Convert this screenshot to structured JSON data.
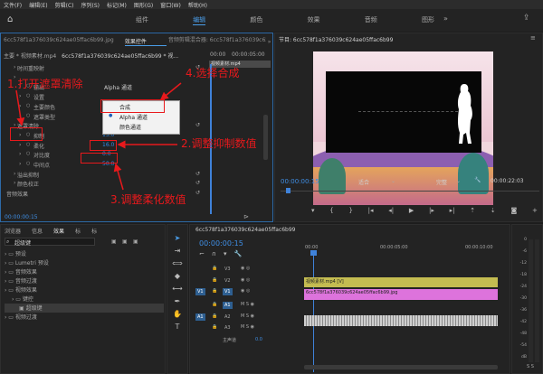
{
  "menu": [
    "文件(F)",
    "编辑(E)",
    "剪辑(C)",
    "序列(S)",
    "标记(M)",
    "图形(G)",
    "窗口(W)",
    "帮助(H)"
  ],
  "workspaces": [
    "组件",
    "编辑",
    "颜色",
    "效果",
    "音频",
    "图形"
  ],
  "source_tabs": {
    "file": "6cc578f1a376039c624ae05ffac6b99.jpg",
    "effect_controls": "效果控件",
    "audio_mixer": "音频剪辑混合器: 6cc578f1a376039c624ae05ffac6b99",
    "menu": "»"
  },
  "ec": {
    "clip_path": "主要 * 视频素材.mp4",
    "clip_seq": "6cc578f1a376039c624ae05ffac6b99 * 视...",
    "ruler_start": "00:00",
    "ruler_end": "00:00:05:00",
    "clip_label": "视频素材.mp4",
    "rows": [
      {
        "label": "时间重映射",
        "indent": 1
      },
      {
        "label": "",
        "indent": 1
      },
      {
        "label": "输出",
        "indent": 2,
        "value": "Alpha 通道"
      },
      {
        "label": "设置",
        "indent": 2
      },
      {
        "label": "主要颜色",
        "indent": 2
      },
      {
        "label": "遮罩类型",
        "indent": 2
      },
      {
        "label": "遮罩清除",
        "indent": 1
      },
      {
        "label": "抑制",
        "indent": 2,
        "value": "13.0"
      },
      {
        "label": "柔化",
        "indent": 2,
        "value": "16.0"
      },
      {
        "label": "对比度",
        "indent": 2,
        "value": "0.0"
      },
      {
        "label": "中间点",
        "indent": 2,
        "value": "50.0"
      },
      {
        "label": "溢出抑制",
        "indent": 1
      },
      {
        "label": "颜色校正",
        "indent": 1
      },
      {
        "label": "音频效果",
        "indent": 0
      }
    ],
    "timecode": "00:00:00:15",
    "dropdown": [
      {
        "label": "合成",
        "checked": false
      },
      {
        "label": "Alpha 通道",
        "checked": true
      },
      {
        "label": "颜色通道",
        "checked": false
      }
    ]
  },
  "program": {
    "title": "节目: 6cc578f1a376039c624ae05ffac6b99",
    "timecode": "00:00:00:15",
    "fit": "适合",
    "quality": "完整",
    "duration": "00:00:22:03"
  },
  "project": {
    "tabs": [
      "浏览器",
      "信息",
      "效果",
      "标",
      "标"
    ],
    "search": "超级键",
    "items": [
      {
        "label": "预设",
        "indent": 0
      },
      {
        "label": "Lumetri 预设",
        "indent": 0
      },
      {
        "label": "音频效果",
        "indent": 0
      },
      {
        "label": "音频过渡",
        "indent": 0
      },
      {
        "label": "视频效果",
        "indent": 0
      },
      {
        "label": "键控",
        "indent": 1
      },
      {
        "label": "超级键",
        "indent": 2
      },
      {
        "label": "视频过渡",
        "indent": 0
      }
    ]
  },
  "timeline": {
    "tab": "6cc578f1a376039c624ae05ffac6b99",
    "timecode": "00:00:00:15",
    "ruler": [
      "00:00",
      "00:00:05:00",
      "00:00:10:00"
    ],
    "tracks": [
      {
        "name": "V3"
      },
      {
        "name": "V2"
      },
      {
        "name": "V1"
      },
      {
        "name": "A1"
      },
      {
        "name": "A2"
      },
      {
        "name": "A3"
      }
    ],
    "master": "主声道",
    "master_value": "0.0",
    "clip_v2": "视频素材.mp4 [V]",
    "clip_v1": "6cc578f1a376039c624ae05ffac6b99.jpg",
    "source_patch_v": "V1",
    "source_patch_a": "A1"
  },
  "meter": {
    "labels": [
      "0",
      "-6",
      "-12",
      "-18",
      "-24",
      "-30",
      "-36",
      "-42",
      "-48",
      "-54",
      "dB"
    ],
    "bottom": "S  S"
  },
  "annotations": {
    "step1": "1.打开遮罩清除",
    "step2": "2.调整抑制数值",
    "step3": "3.调整柔化数值",
    "step4": "4.选择合成"
  },
  "colors": {
    "accent": "#2d8ceb",
    "annotation": "#e8191c",
    "clip_v2": "#c4bc51",
    "clip_v1": "#dd73dc",
    "audio": "#cfcfcf"
  }
}
